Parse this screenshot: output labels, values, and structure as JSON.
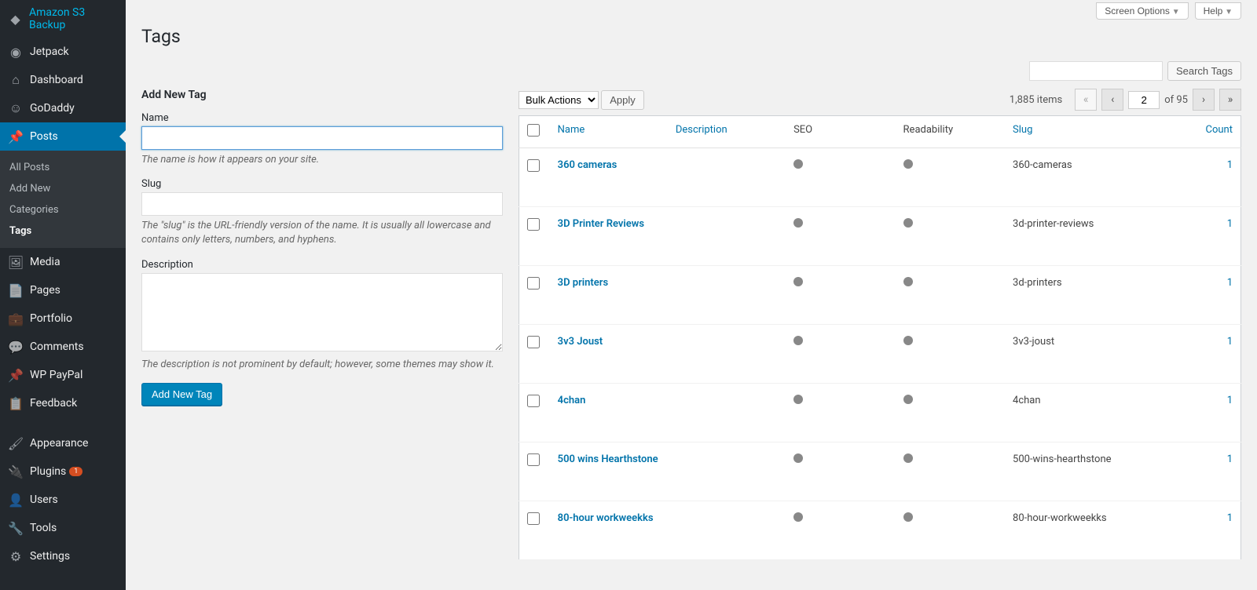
{
  "topbar": {
    "screen_options": "Screen Options",
    "help": "Help"
  },
  "sidebar": {
    "items": [
      {
        "label": "Amazon S3 Backup",
        "icon": "◆"
      },
      {
        "label": "Jetpack",
        "icon": "◉"
      },
      {
        "label": "Dashboard",
        "icon": "⌂"
      },
      {
        "label": "GoDaddy",
        "icon": "☺"
      },
      {
        "label": "Posts",
        "icon": "📌",
        "current": true
      },
      {
        "label": "Media",
        "icon": "🖼"
      },
      {
        "label": "Pages",
        "icon": "📄"
      },
      {
        "label": "Portfolio",
        "icon": "💼"
      },
      {
        "label": "Comments",
        "icon": "💬"
      },
      {
        "label": "WP PayPal",
        "icon": "📌"
      },
      {
        "label": "Feedback",
        "icon": "📋"
      },
      {
        "label": "Appearance",
        "icon": "🖌"
      },
      {
        "label": "Plugins",
        "icon": "🔌",
        "badge": "1"
      },
      {
        "label": "Users",
        "icon": "👤"
      },
      {
        "label": "Tools",
        "icon": "🔧"
      },
      {
        "label": "Settings",
        "icon": "⚙"
      }
    ],
    "submenu": [
      {
        "label": "All Posts"
      },
      {
        "label": "Add New"
      },
      {
        "label": "Categories"
      },
      {
        "label": "Tags",
        "current": true
      }
    ]
  },
  "page": {
    "title": "Tags"
  },
  "form": {
    "heading": "Add New Tag",
    "name_label": "Name",
    "name_desc": "The name is how it appears on your site.",
    "slug_label": "Slug",
    "slug_desc": "The \"slug\" is the URL-friendly version of the name. It is usually all lowercase and contains only letters, numbers, and hyphens.",
    "desc_label": "Description",
    "desc_desc": "The description is not prominent by default; however, some themes may show it.",
    "submit": "Add New Tag"
  },
  "search": {
    "button": "Search Tags"
  },
  "bulk": {
    "label": "Bulk Actions",
    "apply": "Apply"
  },
  "paging": {
    "items_text": "1,885 items",
    "current": "2",
    "total_text": "of 95"
  },
  "table": {
    "headers": {
      "name": "Name",
      "description": "Description",
      "seo": "SEO",
      "readability": "Readability",
      "slug": "Slug",
      "count": "Count"
    },
    "rows": [
      {
        "name": "360 cameras",
        "slug": "360-cameras",
        "count": "1"
      },
      {
        "name": "3D Printer Reviews",
        "slug": "3d-printer-reviews",
        "count": "1"
      },
      {
        "name": "3D printers",
        "slug": "3d-printers",
        "count": "1"
      },
      {
        "name": "3v3 Joust",
        "slug": "3v3-joust",
        "count": "1"
      },
      {
        "name": "4chan",
        "slug": "4chan",
        "count": "1"
      },
      {
        "name": "500 wins Hearthstone",
        "slug": "500-wins-hearthstone",
        "count": "1"
      },
      {
        "name": "80-hour workweekks",
        "slug": "80-hour-workweekks",
        "count": "1"
      }
    ]
  }
}
